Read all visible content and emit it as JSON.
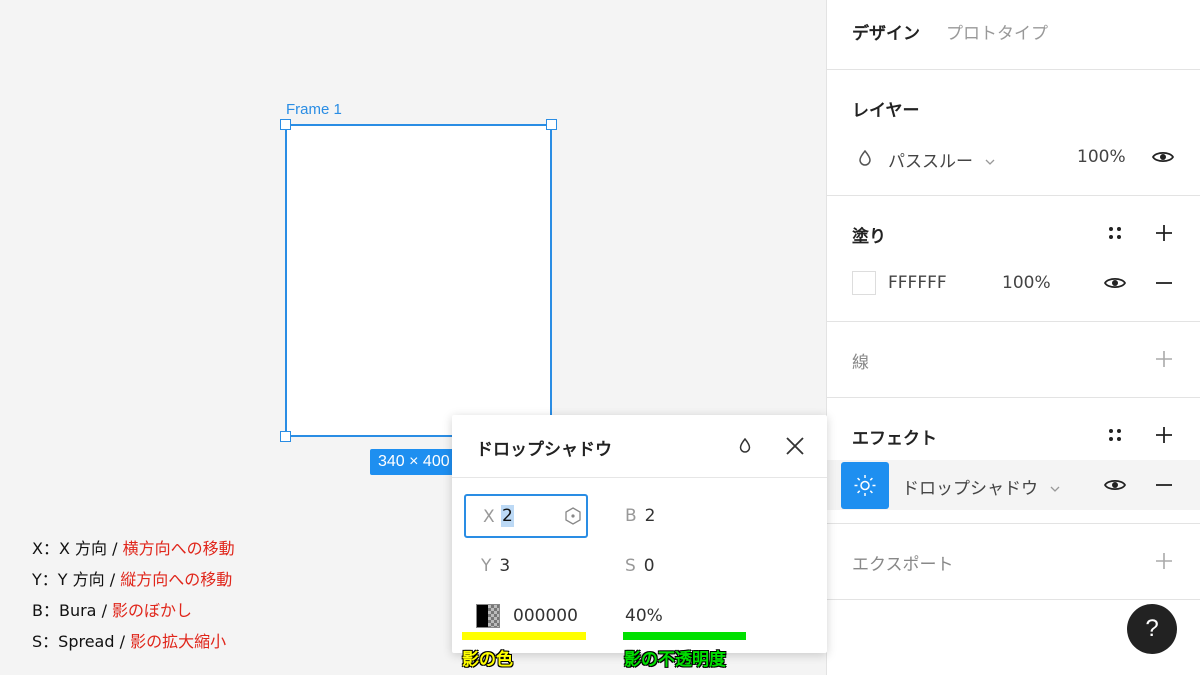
{
  "canvas": {
    "frame_label": "Frame 1",
    "size_badge": "340 × 400"
  },
  "legend": [
    {
      "key": "X：X 方向 / ",
      "desc": "横方向への移動"
    },
    {
      "key": "Y：Y 方向 / ",
      "desc": "縦方向への移動"
    },
    {
      "key": "B：Bura / ",
      "desc": "影のぼかし"
    },
    {
      "key": "S：Spread / ",
      "desc": "影の拡大縮小"
    }
  ],
  "popup": {
    "title": "ドロップシャドウ",
    "x_label": "X",
    "x_value": "2",
    "b_label": "B",
    "b_value": "2",
    "y_label": "Y",
    "y_value": "3",
    "s_label": "S",
    "s_value": "0",
    "color_value": "000000",
    "opacity_value": "40%",
    "note_color": "影の色",
    "note_opacity": "影の不透明度"
  },
  "panel": {
    "tabs": {
      "design": "デザイン",
      "prototype": "プロトタイプ"
    },
    "layer": {
      "title": "レイヤー",
      "blend_mode": "パススルー",
      "opacity": "100%"
    },
    "fill": {
      "title": "塗り",
      "hex": "FFFFFF",
      "opacity": "100%"
    },
    "stroke": {
      "title": "線"
    },
    "effect": {
      "title": "エフェクト",
      "type": "ドロップシャドウ"
    },
    "export": {
      "title": "エクスポート"
    },
    "help": "?"
  },
  "colors": {
    "accent": "#1e8ff0",
    "selection": "#2a8de4",
    "legend_red": "#e0261b",
    "highlight_yellow": "#ffff00",
    "highlight_green": "#00e000"
  },
  "icons": [
    "drop-icon",
    "close-icon",
    "hexagon-icon",
    "eye-icon",
    "grid-dots-icon",
    "plus-icon",
    "minus-icon",
    "sun-icon",
    "chevron-down-icon",
    "help-icon"
  ]
}
